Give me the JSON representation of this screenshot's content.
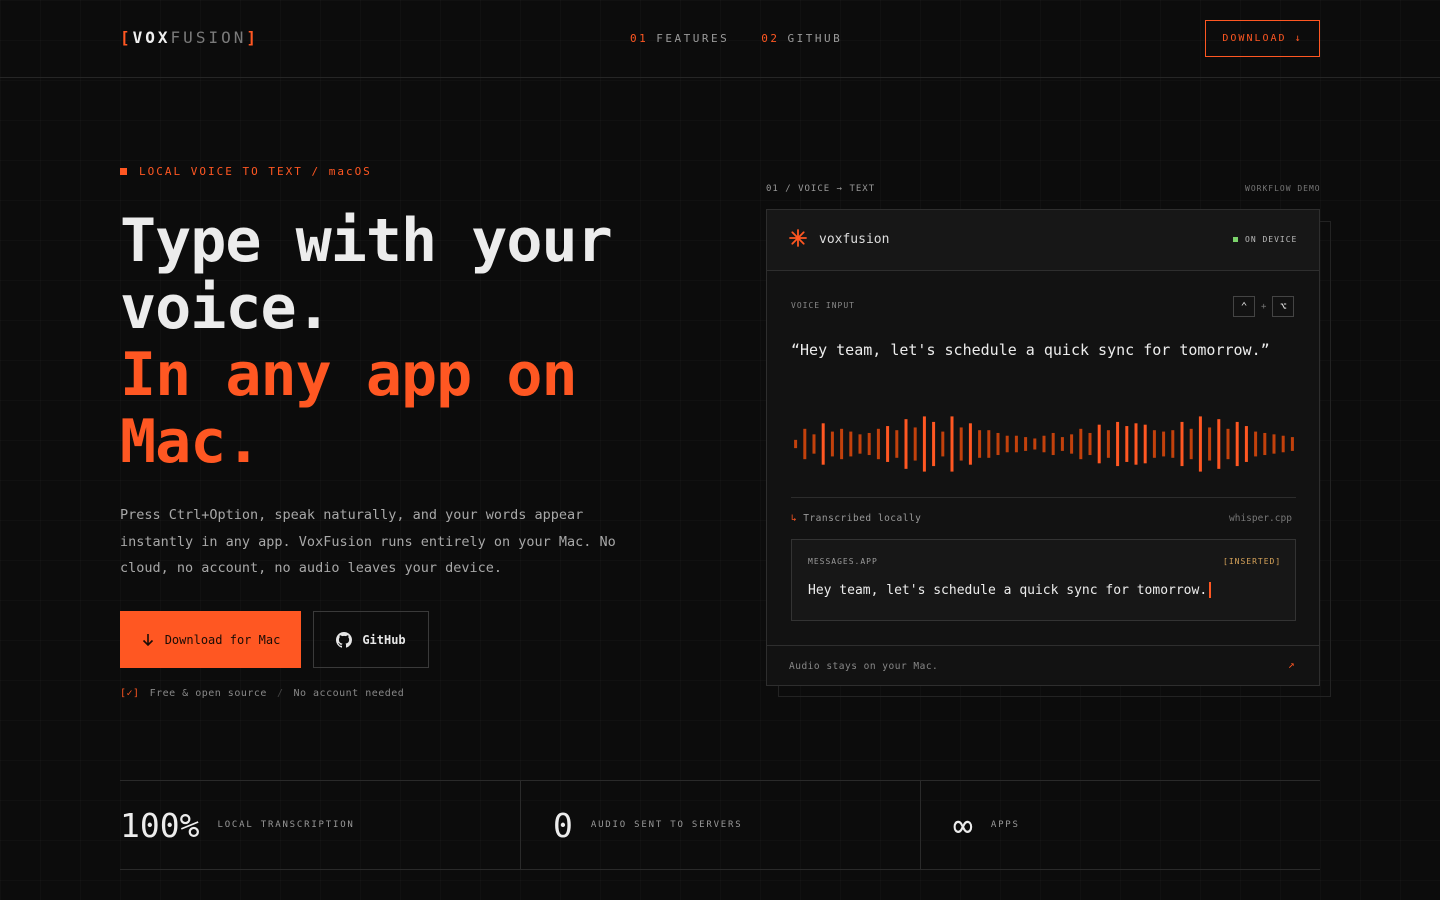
{
  "header": {
    "logo": {
      "open": "[",
      "part1": "VOX",
      "part2": "FUSION",
      "close": "]"
    },
    "nav": [
      {
        "num": "01",
        "label": "FEATURES"
      },
      {
        "num": "02",
        "label": "GITHUB"
      }
    ],
    "download_label": "DOWNLOAD ↓"
  },
  "hero": {
    "eyebrow": "LOCAL VOICE TO TEXT / macOS",
    "headline_line1": "Type with your voice.",
    "headline_line2": "In any app on Mac.",
    "description": "Press Ctrl+Option, speak naturally, and your words appear instantly in any app. VoxFusion runs entirely on your Mac. No cloud, no account, no audio leaves your device.",
    "primary_button": "Download for Mac",
    "secondary_button": "GitHub",
    "notes": {
      "check": "[✓]",
      "note1": "Free & open source",
      "sep": "/",
      "note2": "No account needed"
    }
  },
  "demo": {
    "label_left": "01 / VOICE → TEXT",
    "label_right": "WORKFLOW DEMO",
    "app_name": "voxfusion",
    "status": "ON DEVICE",
    "voice_input_label": "VOICE INPUT",
    "keys": [
      "⌃",
      "⌥"
    ],
    "plus": "+",
    "quote": "“Hey team, let's schedule a quick sync for tomorrow.”",
    "transcribed_arrow": "↳",
    "transcribed": "Transcribed locally",
    "engine": "whisper.cpp",
    "message_app": "MESSAGES.APP",
    "inserted": "[INSERTED]",
    "message_text": "Hey team, let's schedule a quick sync for tomorrow.",
    "footer": "Audio stays on your Mac.",
    "footer_arrow": "↗",
    "waveform": [
      0.15,
      0.55,
      0.35,
      0.75,
      0.45,
      0.55,
      0.45,
      0.35,
      0.4,
      0.55,
      0.65,
      0.5,
      0.9,
      0.6,
      1.0,
      0.8,
      0.45,
      1.0,
      0.6,
      0.75,
      0.5,
      0.5,
      0.4,
      0.3,
      0.3,
      0.25,
      0.2,
      0.3,
      0.4,
      0.25,
      0.35,
      0.55,
      0.4,
      0.7,
      0.5,
      0.8,
      0.65,
      0.75,
      0.7,
      0.5,
      0.45,
      0.5,
      0.8,
      0.55,
      1.0,
      0.6,
      0.9,
      0.55,
      0.8,
      0.65,
      0.45,
      0.4,
      0.35,
      0.3,
      0.25
    ],
    "colors": {
      "accent": "#ff5722",
      "wave_dark": "#c2410c"
    }
  },
  "stats": [
    {
      "value": "100%",
      "label": "LOCAL TRANSCRIPTION"
    },
    {
      "value": "0",
      "label": "AUDIO SENT TO SERVERS"
    },
    {
      "value": "∞",
      "label": "APPS"
    }
  ]
}
